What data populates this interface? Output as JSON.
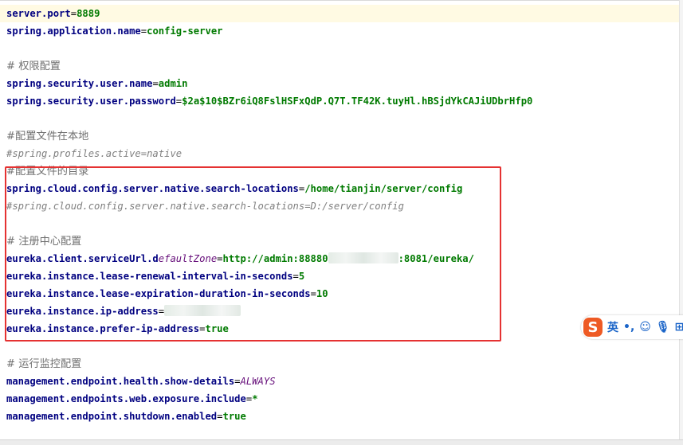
{
  "editor": {
    "lines": [
      {
        "type": "kv",
        "key": "server.port",
        "value": "8889"
      },
      {
        "type": "kv",
        "key": "spring.application.name",
        "value": "config-server"
      },
      {
        "type": "blank"
      },
      {
        "type": "comment",
        "text": "# 权限配置"
      },
      {
        "type": "kv",
        "key": "spring.security.user.name",
        "value": "admin"
      },
      {
        "type": "kv",
        "key": "spring.security.user.password",
        "value": "$2a$10$BZr6iQ8FslHSFxQdP.Q7T.TF42K.tuyHl.hBSjdYkCAJiUDbrHfp0"
      },
      {
        "type": "blank"
      },
      {
        "type": "comment",
        "text": "#配置文件在本地"
      },
      {
        "type": "disabled",
        "text": "#spring.profiles.active=native"
      },
      {
        "type": "comment",
        "text": "#配置文件的目录"
      },
      {
        "type": "kv",
        "key": "spring.cloud.config.server.native.search-locations",
        "value": "/home/tianjin/server/config"
      },
      {
        "type": "disabled",
        "text": "#spring.cloud.config.server.native.search-locations=D:/server/config"
      },
      {
        "type": "blank"
      },
      {
        "type": "comment",
        "text": "# 注册中心配置"
      },
      {
        "type": "eureka_url",
        "key_a": "eureka.client.serviceUrl.d",
        "key_b": "efaultZone",
        "value_a": "http://admin:88880",
        "value_b": ":8081/eureka/"
      },
      {
        "type": "kv",
        "key": "eureka.instance.lease-renewal-interval-in-seconds",
        "value": "5"
      },
      {
        "type": "kv",
        "key": "eureka.instance.lease-expiration-duration-in-seconds",
        "value": "10"
      },
      {
        "type": "kv_blur",
        "key": "eureka.instance.ip-address",
        "value": ""
      },
      {
        "type": "kv",
        "key": "eureka.instance.prefer-ip-address",
        "value": "true"
      },
      {
        "type": "blank"
      },
      {
        "type": "comment",
        "text": "# 运行监控配置"
      },
      {
        "type": "kv_ital",
        "key": "management.endpoint.health.show-details",
        "value": "ALWAYS"
      },
      {
        "type": "kv",
        "key": "management.endpoints.web.exposure.include",
        "value": "*"
      },
      {
        "type": "kv",
        "key": "management.endpoint.shutdown.enabled",
        "value": "true"
      }
    ]
  },
  "ime_toolbar": {
    "logo": "S",
    "lang": "英",
    "icons": [
      "punctuation-icon",
      "emoji-icon",
      "microphone-icon",
      "keyboard-icon"
    ],
    "icon_glyphs": [
      "•,",
      "☺",
      "🎙",
      "⊞"
    ]
  },
  "colors": {
    "key": "#000080",
    "value": "#007a00",
    "comment": "#808080",
    "highlight_box": "#e53232"
  }
}
